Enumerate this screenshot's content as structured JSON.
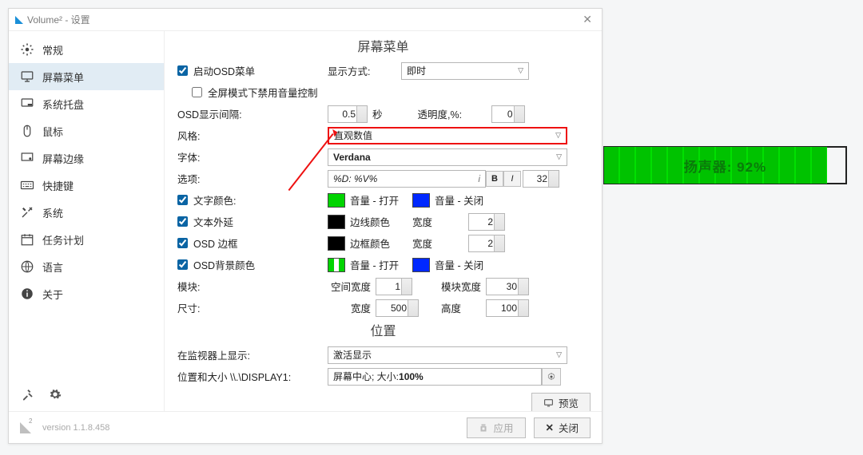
{
  "window": {
    "title": "Volume² - 设置",
    "close_glyph": "✕"
  },
  "sidebar": {
    "items": [
      {
        "icon": "gear",
        "label": "常规"
      },
      {
        "icon": "monitor",
        "label": "屏幕菜单"
      },
      {
        "icon": "tray",
        "label": "系统托盘"
      },
      {
        "icon": "mouse",
        "label": "鼠标"
      },
      {
        "icon": "edge",
        "label": "屏幕边缘"
      },
      {
        "icon": "keyboard",
        "label": "快捷键"
      },
      {
        "icon": "tools",
        "label": "系统"
      },
      {
        "icon": "calendar",
        "label": "任务计划"
      },
      {
        "icon": "globe",
        "label": "语言"
      },
      {
        "icon": "info",
        "label": "关于"
      }
    ],
    "active_index": 1
  },
  "section1_title": "屏幕菜单",
  "enable_osd": {
    "label": "启动OSD菜单",
    "checked": true
  },
  "fullscreen_disable": {
    "label": "全屏模式下禁用音量控制",
    "checked": false
  },
  "display_mode": {
    "label": "显示方式:",
    "value": "即时"
  },
  "interval": {
    "label": "OSD显示间隔:",
    "value": "0.5",
    "unit": "秒"
  },
  "opacity": {
    "label": "透明度,%:",
    "value": "0"
  },
  "style": {
    "label": "风格:",
    "value": "直观数值"
  },
  "font": {
    "label": "字体:",
    "value": "Verdana"
  },
  "option": {
    "label": "选项:",
    "value": "%D: %V%",
    "italic_hint": "i",
    "bold": "B",
    "italic": "I",
    "size": "32"
  },
  "text_color": {
    "label": "文字颜色:",
    "checked": true,
    "on_label": "音量 - 打开",
    "off_label": "音量 - 关闭",
    "on_color": "#00d400",
    "off_color": "#0028ff"
  },
  "outline": {
    "label": "文本外延",
    "checked": true,
    "edge_label": "边线颜色",
    "width_label": "宽度",
    "width": "2",
    "color": "#000000"
  },
  "osd_border": {
    "label": "OSD 边框",
    "checked": true,
    "border_label": "边框颜色",
    "width_label": "宽度",
    "width": "2",
    "color": "#000000"
  },
  "osd_bg": {
    "label": "OSD背景颜色",
    "checked": true,
    "on_label": "音量 - 打开",
    "off_label": "音量 - 关闭",
    "on_color": "#00d400",
    "off_color": "#0028ff"
  },
  "module": {
    "label": "模块:",
    "gap_label": "空间宽度",
    "gap": "1",
    "mod_width_label": "模块宽度",
    "mod_width": "30"
  },
  "size": {
    "label": "尺寸:",
    "width_label": "宽度",
    "width": "500",
    "height_label": "高度",
    "height": "100"
  },
  "section2_title": "位置",
  "monitor": {
    "label": "在监视器上显示:",
    "value": "激活显示"
  },
  "pos": {
    "label": "位置和大小 \\\\.\\DISPLAY1:",
    "value_prefix": "屏幕中心; 大小: ",
    "value_bold": "100%"
  },
  "preview_btn": "预览",
  "apply_btn": "应用",
  "close_btn": "关闭",
  "version": "version 1.1.8.458",
  "osd_preview_text": "扬声器: 92%"
}
